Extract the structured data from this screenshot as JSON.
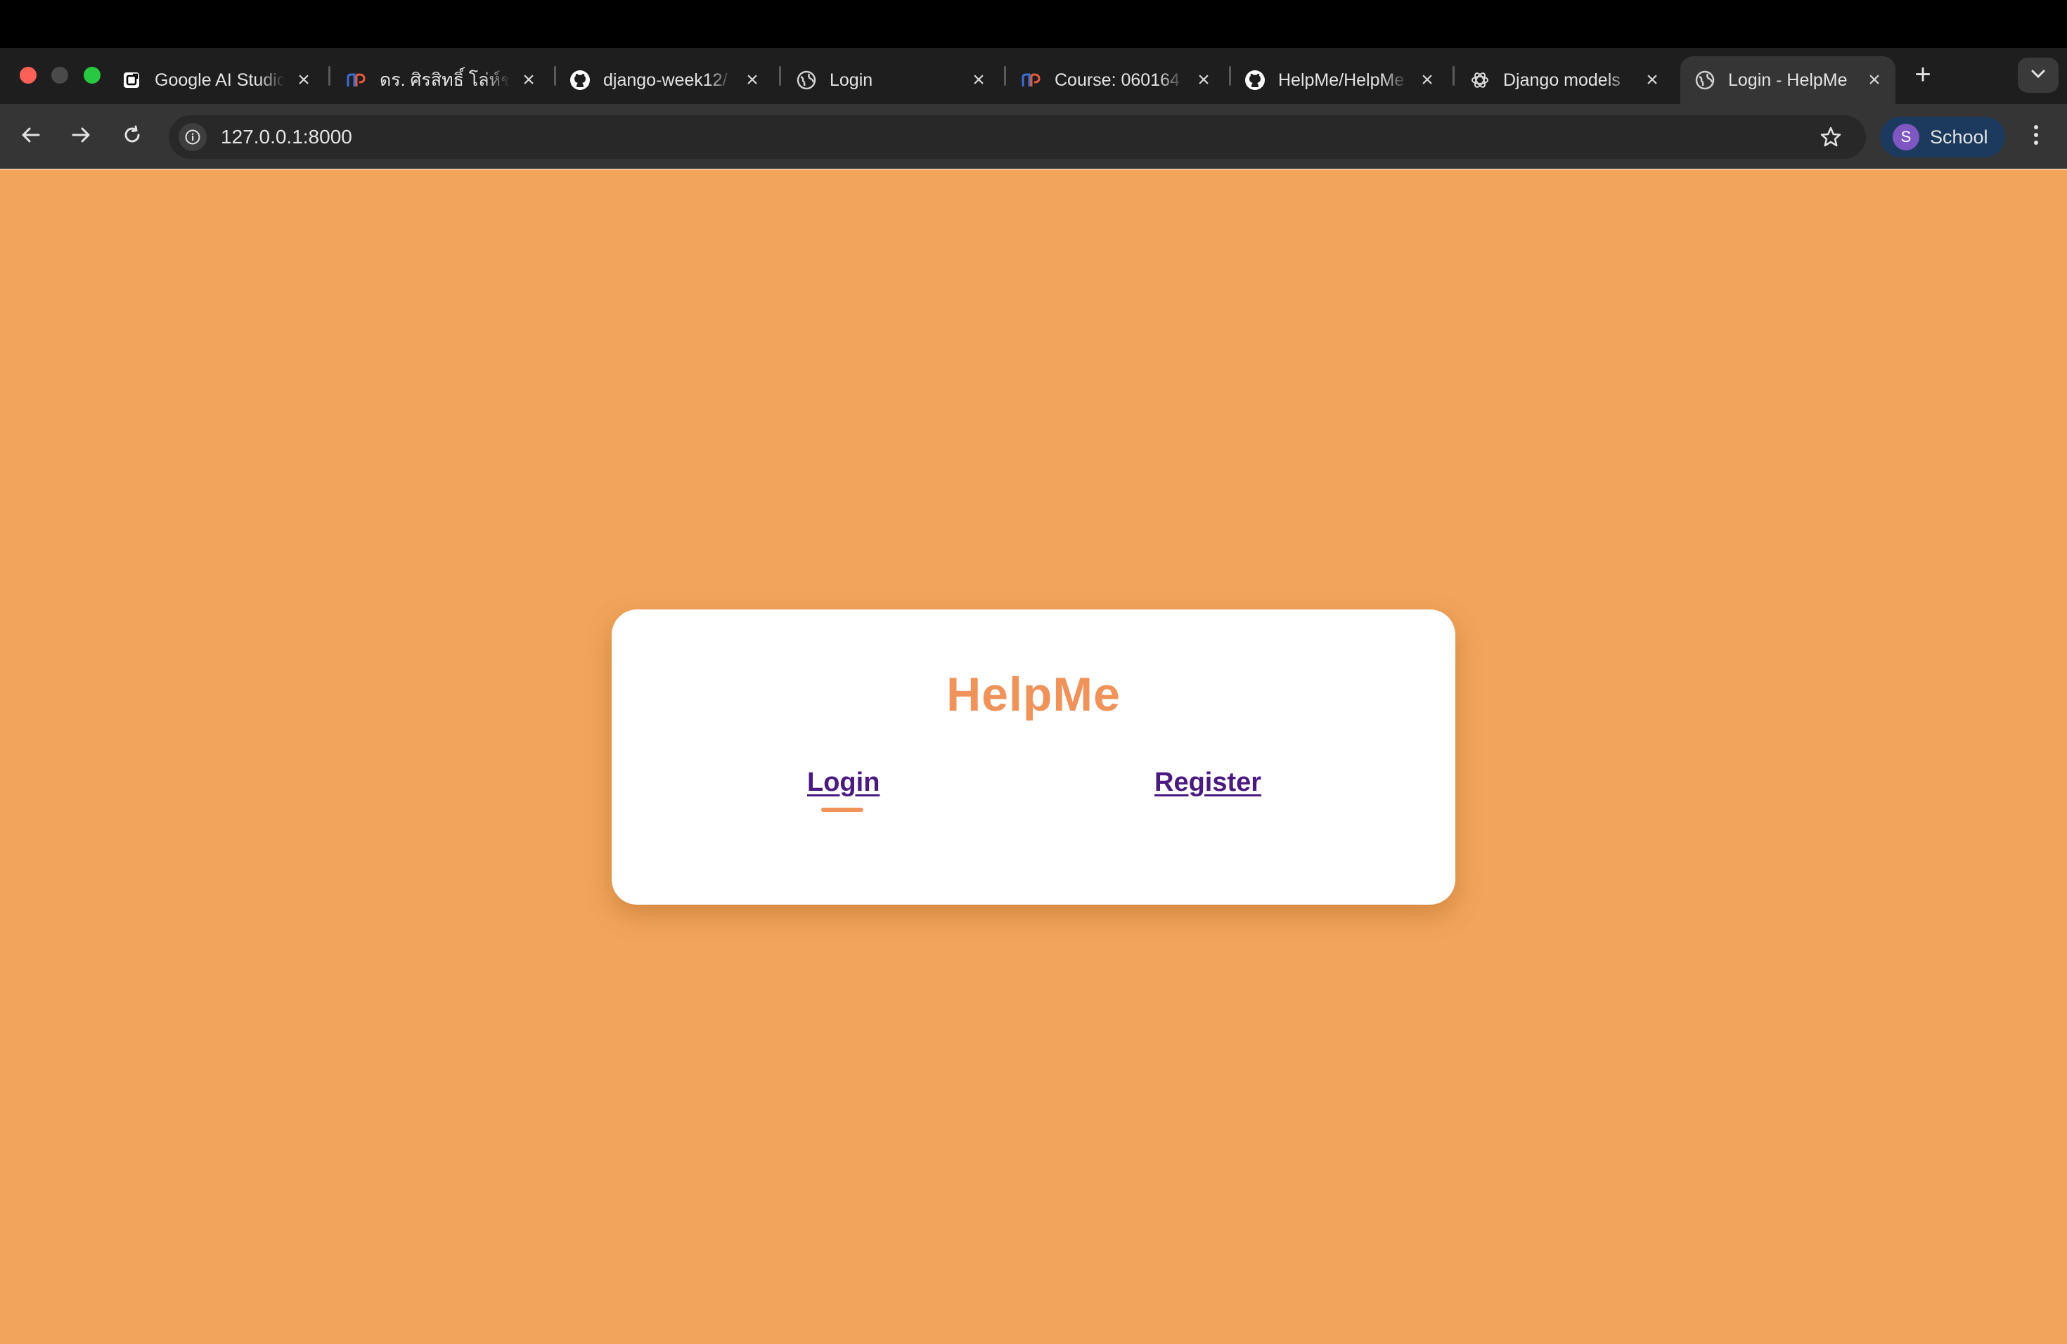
{
  "browser": {
    "tabs": [
      {
        "title": "Google AI Studio",
        "icon": "google-ai-studio-icon"
      },
      {
        "title": "ดร. ศิรสิทธิ์ โล่ห์ชนะ",
        "icon": "mcv-icon"
      },
      {
        "title": "django-week12/",
        "icon": "github-icon"
      },
      {
        "title": "Login",
        "icon": "globe-icon"
      },
      {
        "title": "Course: 060164",
        "icon": "mcv-icon"
      },
      {
        "title": "HelpMe/HelpMe",
        "icon": "github-icon"
      },
      {
        "title": "Django models",
        "icon": "openai-icon"
      },
      {
        "title": "Login - HelpMe",
        "icon": "globe-icon",
        "active": true
      }
    ],
    "close_glyph": "×",
    "new_tab_glyph": "+",
    "address": "127.0.0.1:8000",
    "profile": {
      "initial": "S",
      "name": "School"
    }
  },
  "page": {
    "background_color": "#f2a45a",
    "title": "HelpMe",
    "title_color": "#f0935a",
    "links": {
      "login": "Login",
      "register": "Register"
    },
    "link_color": "#4a1a80",
    "active_link": "login"
  }
}
